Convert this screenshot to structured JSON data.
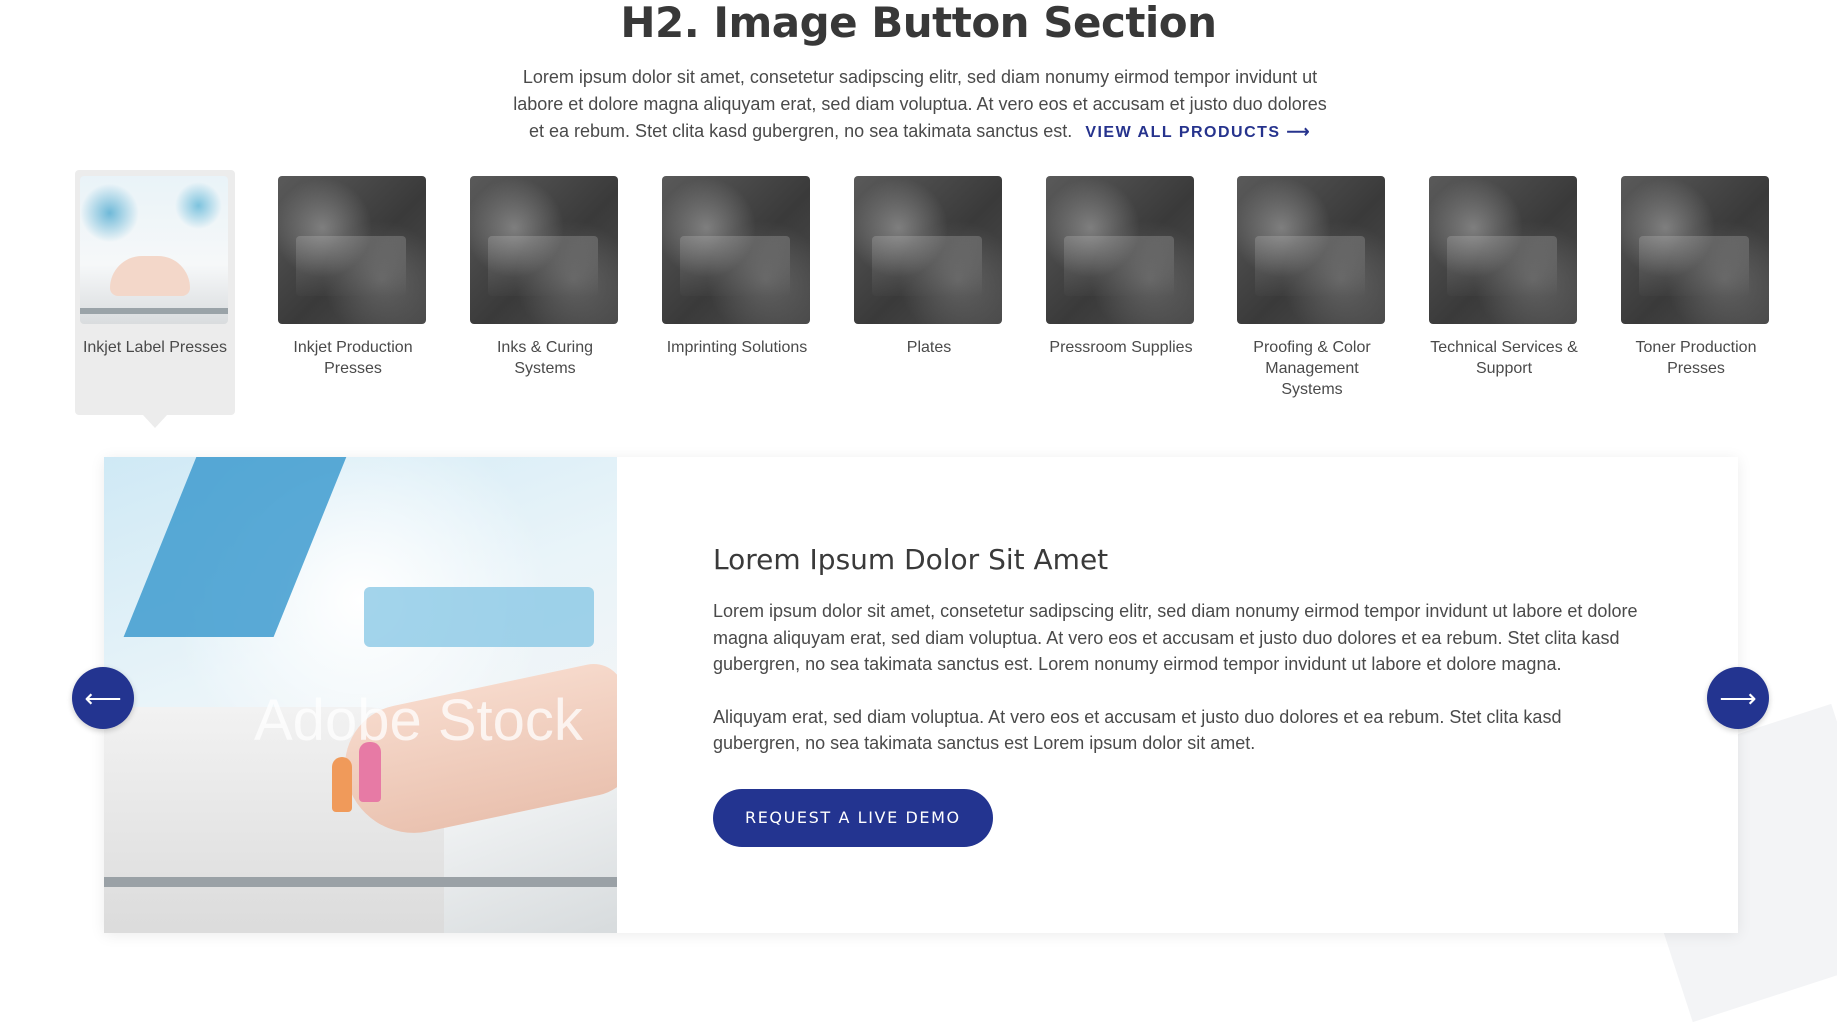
{
  "section": {
    "title": "H2. Image Button Section",
    "intro": "Lorem ipsum dolor sit amet, consetetur sadipscing elitr, sed diam nonumy eirmod tempor invidunt ut labore et dolore magna aliquyam erat, sed diam voluptua. At vero eos et accusam et justo duo dolores et ea rebum. Stet clita kasd gubergren, no sea takimata sanctus est.",
    "view_all_label": "VIEW ALL PRODUCTS ⟶"
  },
  "categories": [
    {
      "label": "Inkjet Label Presses",
      "active": true
    },
    {
      "label": "Inkjet Production Presses",
      "active": false
    },
    {
      "label": "Inks & Curing Systems",
      "active": false
    },
    {
      "label": "Imprinting Solutions",
      "active": false
    },
    {
      "label": "Plates",
      "active": false
    },
    {
      "label": "Pressroom Supplies",
      "active": false
    },
    {
      "label": "Proofing & Color Management Systems",
      "active": false
    },
    {
      "label": "Technical Services & Support",
      "active": false
    },
    {
      "label": "Toner Production Presses",
      "active": false
    }
  ],
  "panel": {
    "watermark": "Adobe Stock",
    "heading": "Lorem Ipsum Dolor Sit Amet",
    "paragraph1": "Lorem ipsum dolor sit amet, consetetur sadipscing elitr, sed diam nonumy eirmod tempor invidunt ut labore et dolore magna aliquyam erat, sed diam voluptua. At vero eos et accusam et justo duo dolores et ea rebum. Stet clita kasd gubergren, no sea takimata sanctus est. Lorem nonumy eirmod tempor invidunt ut labore et dolore magna.",
    "paragraph2": "Aliquyam erat, sed diam voluptua. At vero eos et accusam et justo duo dolores et ea rebum. Stet clita kasd gubergren, no sea takimata sanctus est Lorem ipsum dolor sit amet.",
    "cta_label": "REQUEST A LIVE DEMO"
  },
  "nav": {
    "prev_icon": "⟵",
    "next_icon": "⟶"
  },
  "colors": {
    "brand": "#233490",
    "active_tile": "#ececec"
  }
}
